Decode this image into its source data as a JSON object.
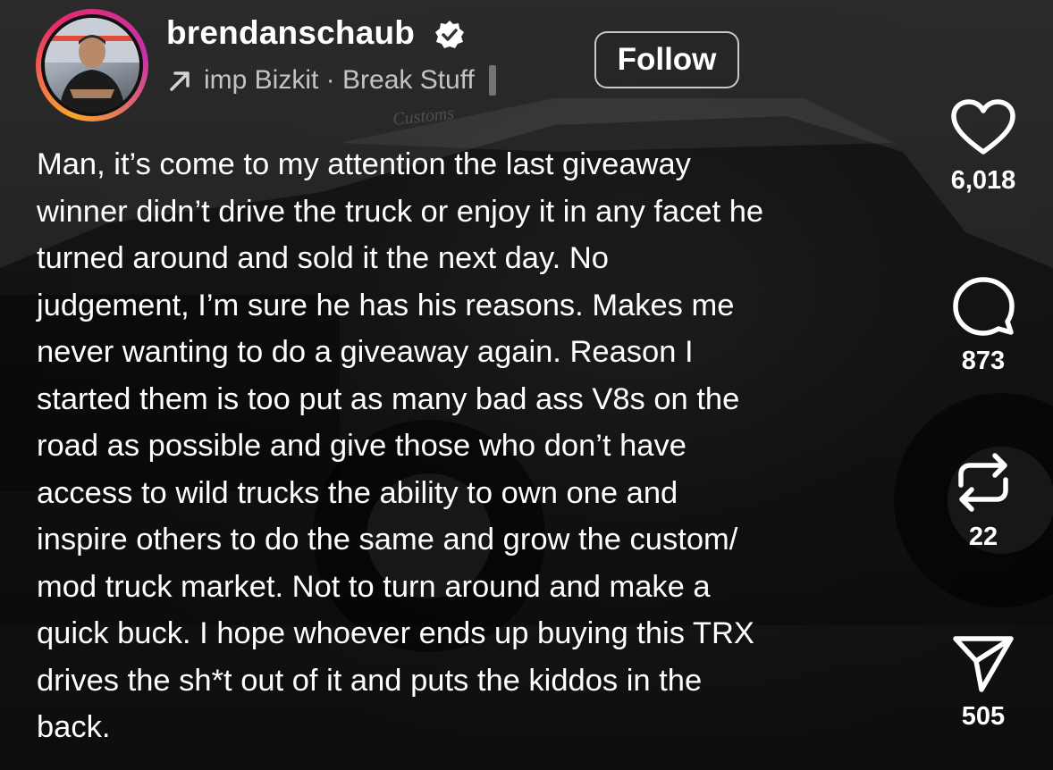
{
  "header": {
    "username": "brendanschaub",
    "song": "imp Bizkit · Break Stuff",
    "follow_label": "Follow"
  },
  "background_text": "Customs",
  "caption": {
    "lines": [
      "Man, it’s come to my attention the last giveaway",
      "winner didn’t drive the truck or enjoy it in any facet he",
      "turned around and sold it the next day. No",
      "judgement, I’m sure he has his reasons. Makes me",
      "never wanting to do a giveaway again. Reason I",
      "started them is too put as many bad ass V8s on the",
      "road as possible and give those who don’t have",
      "access to wild trucks the ability to own one and",
      "inspire others to do the same and grow the custom/",
      "mod truck market. Not to turn around and make a",
      "quick buck. I hope whoever ends up buying this TRX",
      "drives the sh*t out of it and puts the kiddos in the",
      "back."
    ]
  },
  "actions": {
    "likes": "6,018",
    "comments": "873",
    "reposts": "22",
    "shares": "505"
  },
  "icons": {
    "verified": "verified-badge-icon",
    "song": "arrow-up-right-icon",
    "like": "heart-icon",
    "comment": "comment-bubble-icon",
    "repost": "repost-arrows-icon",
    "share": "paper-plane-icon"
  },
  "colors": {
    "text": "#ffffff",
    "story_ring_start": "#f9a52b",
    "story_ring_end": "#c532a8"
  }
}
